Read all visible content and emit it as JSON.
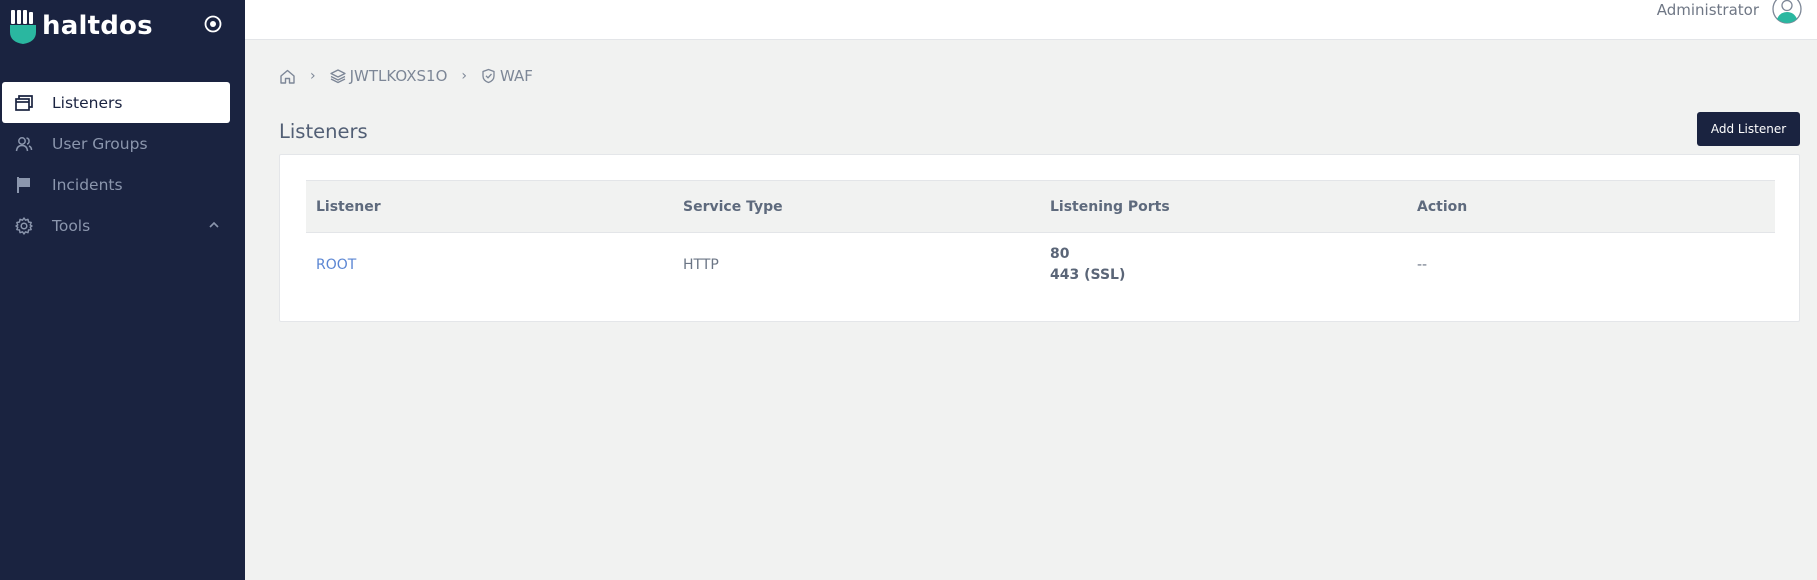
{
  "brand": {
    "name": "haltdos",
    "accent": "#2ab7a0"
  },
  "sidebar": {
    "background": "#1a2340",
    "items": [
      {
        "label": "Listeners",
        "icon": "windows-icon",
        "active": true
      },
      {
        "label": "User Groups",
        "icon": "users-icon",
        "active": false
      },
      {
        "label": "Incidents",
        "icon": "flag-icon",
        "active": false
      },
      {
        "label": "Tools",
        "icon": "gear-icon",
        "active": false,
        "expanded": true
      }
    ]
  },
  "header": {
    "user": "Administrator"
  },
  "breadcrumb": {
    "items": [
      {
        "label": "",
        "icon": "home-icon"
      },
      {
        "label": "JWTLKOXS1O",
        "icon": "layers-icon"
      },
      {
        "label": "WAF",
        "icon": "shield-icon"
      }
    ],
    "separator": "›"
  },
  "page": {
    "title": "Listeners",
    "add_button": "Add Listener"
  },
  "table": {
    "columns": [
      "Listener",
      "Service Type",
      "Listening Ports",
      "Action"
    ],
    "rows": [
      {
        "listener": "ROOT",
        "service_type": "HTTP",
        "ports": [
          "80",
          "443 (SSL)"
        ],
        "action": "--"
      }
    ]
  }
}
